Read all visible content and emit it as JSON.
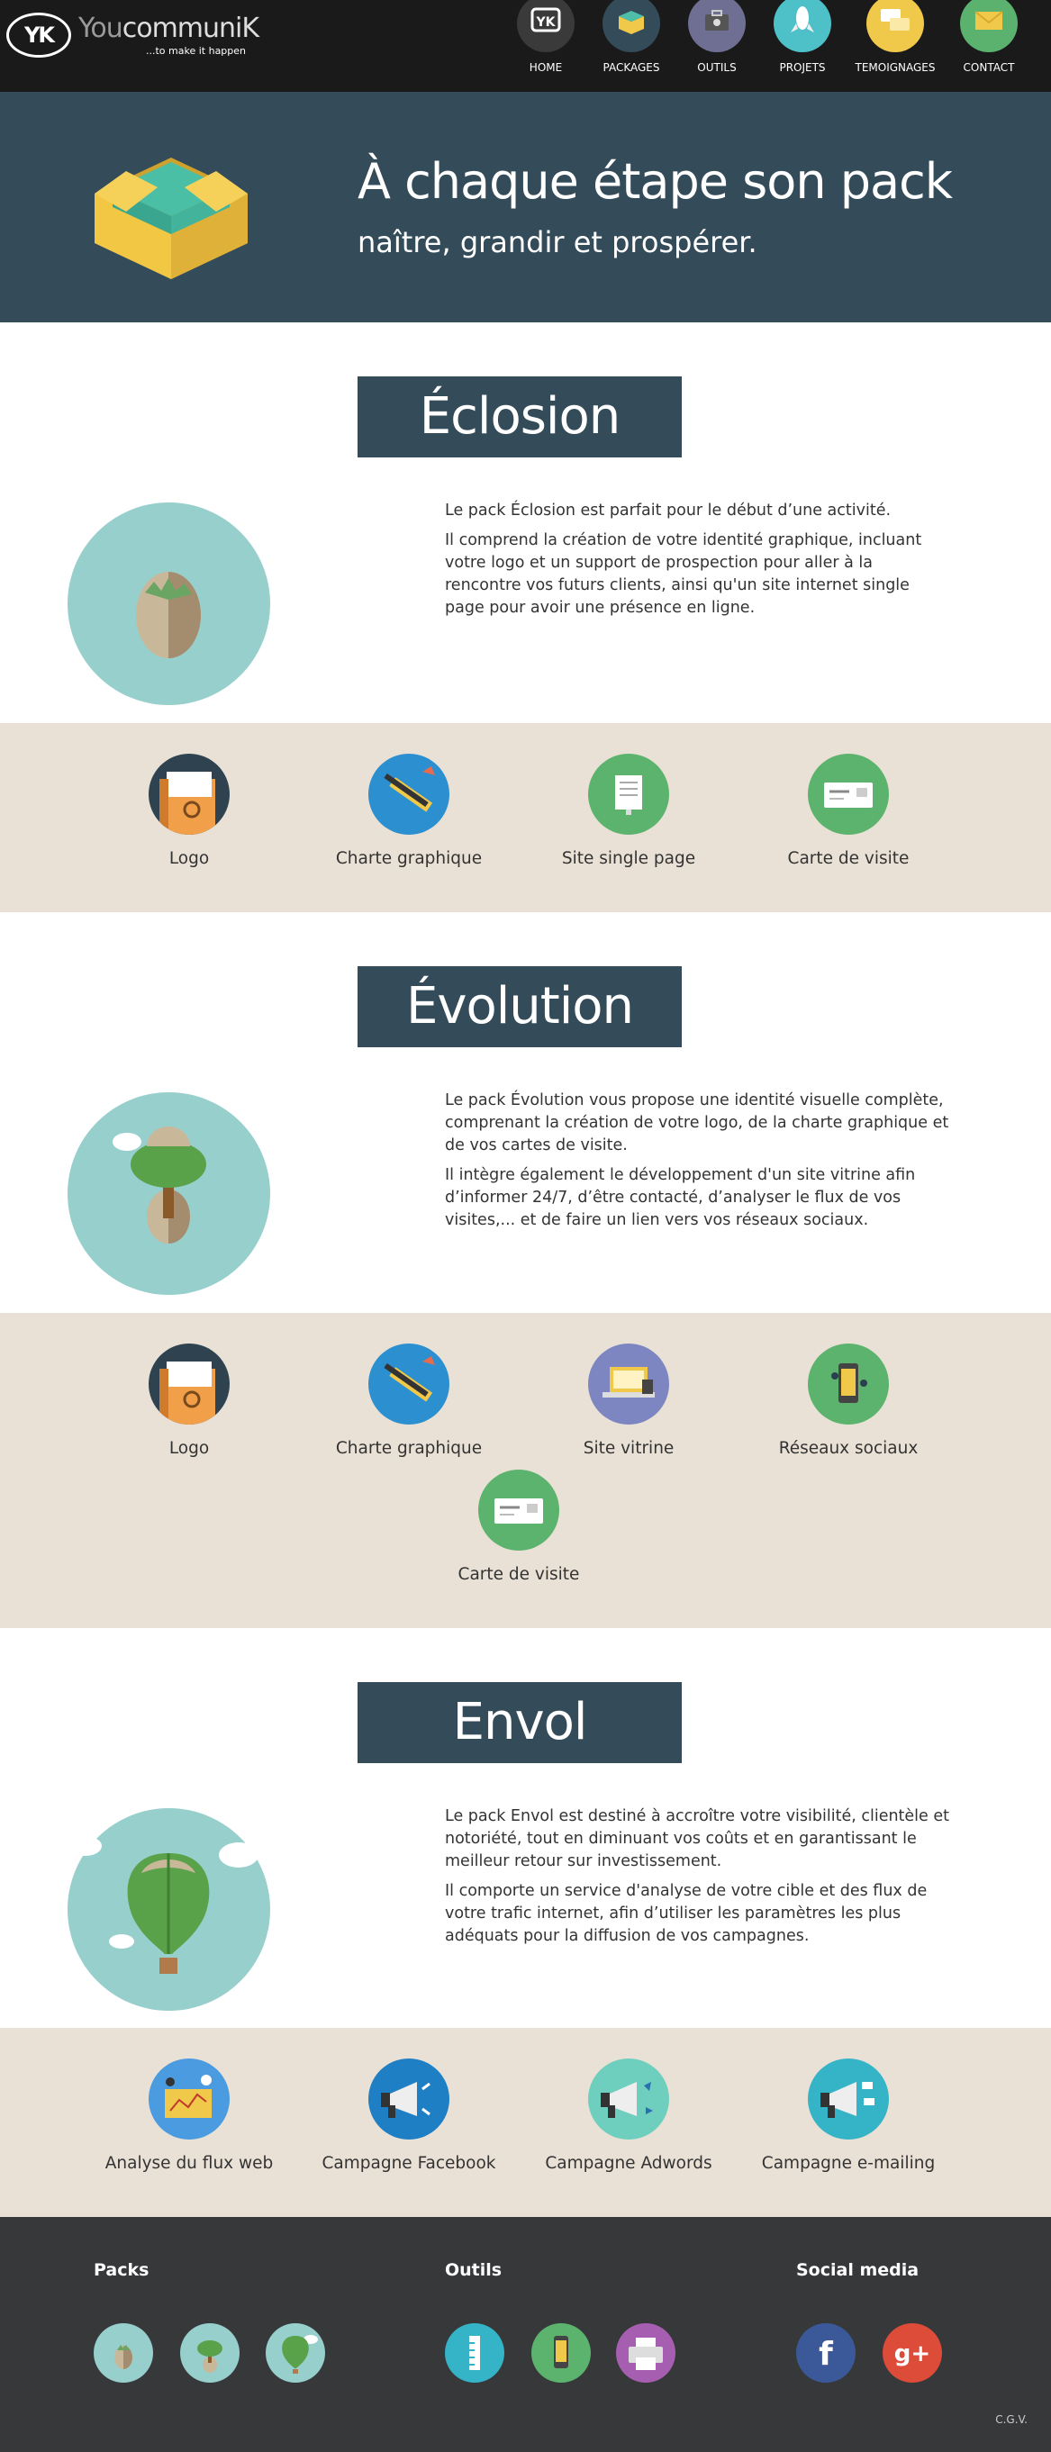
{
  "brand": {
    "mark": "YK",
    "name_prefix": "You",
    "name_main": "communiK",
    "tagline": "...to make it happen"
  },
  "nav": [
    {
      "label": "HOME",
      "icon": "yk-logo-icon",
      "color": "#3a3a3a"
    },
    {
      "label": "PACKAGES",
      "icon": "box-icon",
      "color": "#344b5a"
    },
    {
      "label": "OUTILS",
      "icon": "toolbox-icon",
      "color": "#6e6f92"
    },
    {
      "label": "PROJETS",
      "icon": "rocket-icon",
      "color": "#4dc0c8"
    },
    {
      "label": "TEMOIGNAGES",
      "icon": "speech-bubbles-icon",
      "color": "#f0c84a"
    },
    {
      "label": "CONTACT",
      "icon": "envelope-icon",
      "color": "#5bb26f"
    }
  ],
  "hero": {
    "title": "À chaque étape son pack",
    "subtitle": "naître, grandir et prospérer."
  },
  "packs": [
    {
      "title": "Éclosion",
      "paragraphs": [
        "Le pack Éclosion est parfait pour le début d’une activité.",
        "Il comprend la création de votre identité graphique, incluant votre logo et un support de prospection pour aller à la rencontre vos futurs clients, ainsi qu'un site internet single page pour avoir une présence en ligne."
      ],
      "features": [
        "Logo",
        "Charte graphique",
        "Site single page",
        "Carte de visite"
      ]
    },
    {
      "title": "Évolution",
      "paragraphs": [
        "Le pack Évolution vous propose une identité visuelle complète, comprenant la création de votre logo, de la charte graphique et de vos cartes de visite.",
        "Il intègre également le développement d'un site vitrine afin d’informer 24/7, d’être contacté, d’analyser le flux de vos visites,... et de faire un lien vers vos réseaux sociaux."
      ],
      "features": [
        "Logo",
        "Charte graphique",
        "Site vitrine",
        "Réseaux sociaux",
        "Carte de visite"
      ]
    },
    {
      "title": "Envol",
      "paragraphs": [
        "Le pack Envol est destiné à accroître votre visibilité, clientèle et notoriété, tout en diminuant vos coûts et en garantissant le meilleur retour sur investissement.",
        "Il comporte un service d'analyse de votre cible et des flux de votre trafic internet, afin d’utiliser les paramètres les plus adéquats pour la diffusion de vos campagnes."
      ],
      "features": [
        "Analyse du flux web",
        "Campagne Facebook",
        "Campagne Adwords",
        "Campagne e-mailing"
      ]
    }
  ],
  "footer": {
    "packs_heading": "Packs",
    "tools_heading": "Outils",
    "social_heading": "Social media",
    "social": [
      {
        "icon": "facebook-icon",
        "label": "f",
        "color": "#3b5998"
      },
      {
        "icon": "google-plus-icon",
        "label": "g+",
        "color": "#dd4b39"
      }
    ],
    "cgv": "C.G.V."
  },
  "colors": {
    "dark_blue": "#344b5a",
    "sand": "#e9e1d5",
    "teal": "#97cfcd",
    "footer": "#37383a",
    "nav": "#1a1a1a"
  }
}
